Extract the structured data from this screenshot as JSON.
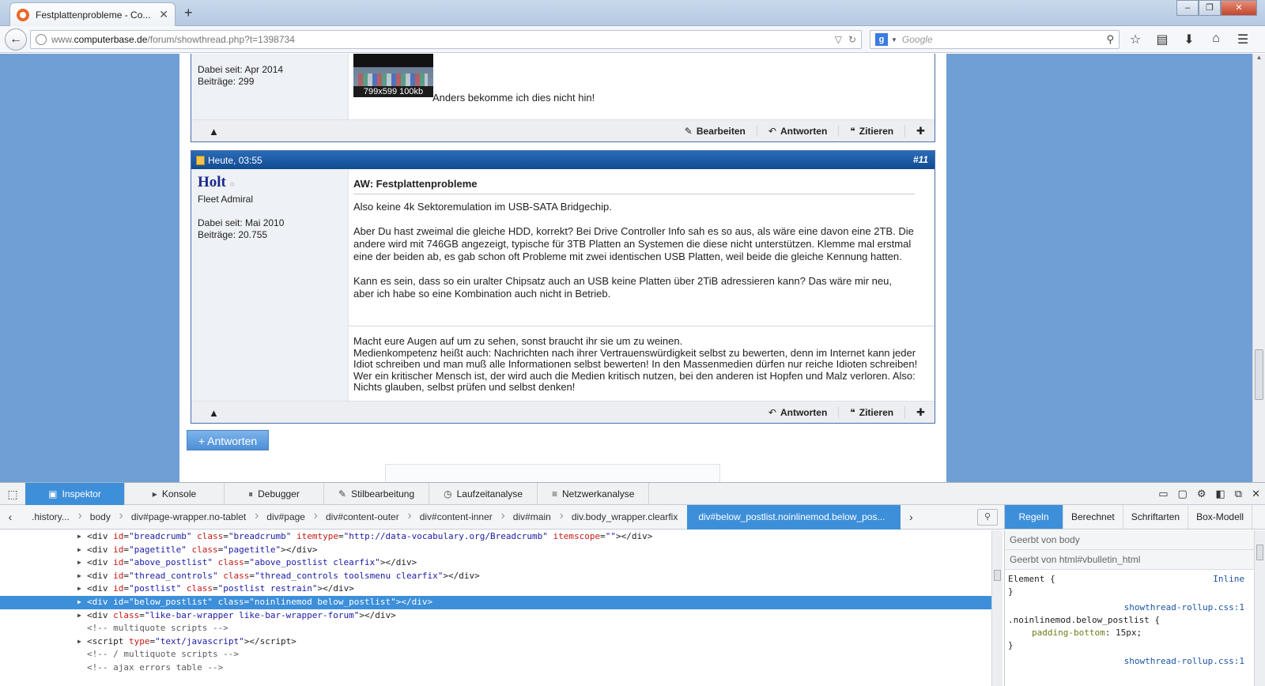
{
  "browser": {
    "tab_title": "Festplattenprobleme - Co...",
    "tab_close": "✕",
    "new_tab": "+",
    "url_prefix": "www.",
    "url_domain": "computerbase.de",
    "url_path": "/forum/showthread.php?t=1398734",
    "search_placeholder": "Google",
    "search_engine_letter": "g"
  },
  "post1": {
    "joined": "Dabei seit: Apr 2014",
    "posts": "Beiträge: 299",
    "thumb_caption": "799x599 100kb",
    "text": "Anders bekomme ich dies nicht hin!",
    "actions": {
      "edit": "Bearbeiten",
      "reply": "Antworten",
      "quote": "Zitieren"
    }
  },
  "post2": {
    "date": "Heute, 03:55",
    "number": "#11",
    "username": "Holt",
    "rank": "Fleet Admiral",
    "joined": "Dabei seit: Mai 2010",
    "posts": "Beiträge: 20.755",
    "title": "AW: Festplattenprobleme",
    "paragraphs": [
      "Also keine 4k Sektoremulation im USB-SATA Bridgechip.",
      "Aber Du hast zweimal die gleiche HDD, korrekt? Bei Drive Controller Info sah es so aus, als wäre eine davon eine 2TB. Die andere wird mit 746GB angezeigt, typische für 3TB Platten an Systemen die diese nicht unterstützen. Klemme mal erstmal eine der beiden ab, es gab schon oft Probleme mit zwei identischen USB Platten, weil beide die gleiche Kennung hatten.",
      "Kann es sein, dass so ein uralter Chipsatz auch an USB keine Platten über 2TiB adressieren kann? Das wäre mir neu, aber ich habe so eine Kombination auch nicht in Betrieb."
    ],
    "signature_line1": "Macht eure Augen auf um zu sehen, sonst braucht ihr sie um zu weinen.",
    "signature_line2": "Medienkompetenz heißt auch: Nachrichten nach ihrer Vertrauenswürdigkeit selbst zu bewerten, denn im Internet kann jeder Idiot schreiben und man muß alle Informationen selbst bewerten! In den Massenmedien dürfen nur reiche Idioten schreiben! Wer ein kritischer Mensch ist, der wird auch die Medien kritisch nutzen, bei den anderen ist Hopfen und Malz verloren. Also: Nichts glauben, selbst prüfen und selbst denken!",
    "actions": {
      "reply": "Antworten",
      "quote": "Zitieren"
    }
  },
  "reply_button": "+ Antworten",
  "devtools": {
    "tabs": [
      "Inspektor",
      "Konsole",
      "Debugger",
      "Stilbearbeitung",
      "Laufzeitanalyse",
      "Netzwerkanalyse"
    ],
    "breadcrumbs": [
      ".history...",
      "body",
      "div#page-wrapper.no-tablet",
      "div#page",
      "div#content-outer",
      "div#content-inner",
      "div#main",
      "div.body_wrapper.clearfix",
      "div#below_postlist.noinlinemod.below_pos..."
    ],
    "side_tabs": [
      "Regeln",
      "Berechnet",
      "Schriftarten",
      "Box-Modell"
    ],
    "inherited_body": "Geerbt von body",
    "inherited_html": "Geerbt von html#vbulletin_html",
    "element_rule": "Element {",
    "inline": "Inline",
    "close_brace": "}",
    "rule1_source": "showthread-rollup.css:1",
    "rule1_selector": ".noinlinemod.below_postlist {",
    "rule1_prop": "padding-bottom",
    "rule1_value": "15px",
    "rule2_source": "showthread-rollup.css:1"
  },
  "colors": {
    "accent": "#3d8fd9",
    "page_bg": "#6f9fd4",
    "post_header": "#114b92",
    "username": "#1c2a8c"
  }
}
